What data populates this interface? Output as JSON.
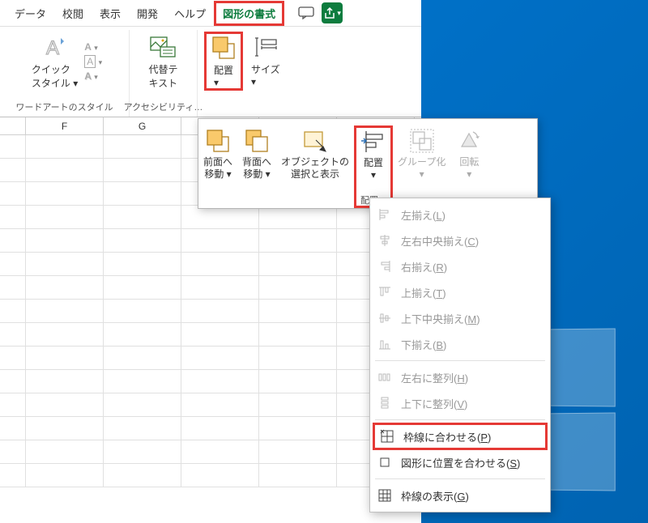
{
  "tabs": {
    "data": "データ",
    "review": "校閲",
    "view": "表示",
    "dev": "開発",
    "help": "ヘルプ",
    "shape_format": "図形の書式"
  },
  "ribbon": {
    "quick_style": "クイック\nスタイル ▾",
    "wordart_label": "ワードアートのスタイル",
    "alt_text": "代替テ\nキスト",
    "access_label": "アクセシビリティ…",
    "arrange": "配置\n▾",
    "size": "サイズ\n▾"
  },
  "popup": {
    "bring_forward": "前面へ\n移動 ▾",
    "send_backward": "背面へ\n移動 ▾",
    "selection_pane": "オブジェクトの\n選択と表示",
    "align": "配置\n▾",
    "group": "グループ化\n▾",
    "rotate": "回転\n▾",
    "group_label": "配置"
  },
  "menu": {
    "align_left": "左揃え(L)",
    "align_center_h": "左右中央揃え(C)",
    "align_right": "右揃え(R)",
    "align_top": "上揃え(T)",
    "align_middle_v": "上下中央揃え(M)",
    "align_bottom": "下揃え(B)",
    "distribute_h": "左右に整列(H)",
    "distribute_v": "上下に整列(V)",
    "snap_to_grid": "枠線に合わせる(P)",
    "snap_to_shape": "図形に位置を合わせる(S)",
    "view_gridlines": "枠線の表示(G)"
  },
  "columns": {
    "f": "F",
    "g": "G"
  }
}
